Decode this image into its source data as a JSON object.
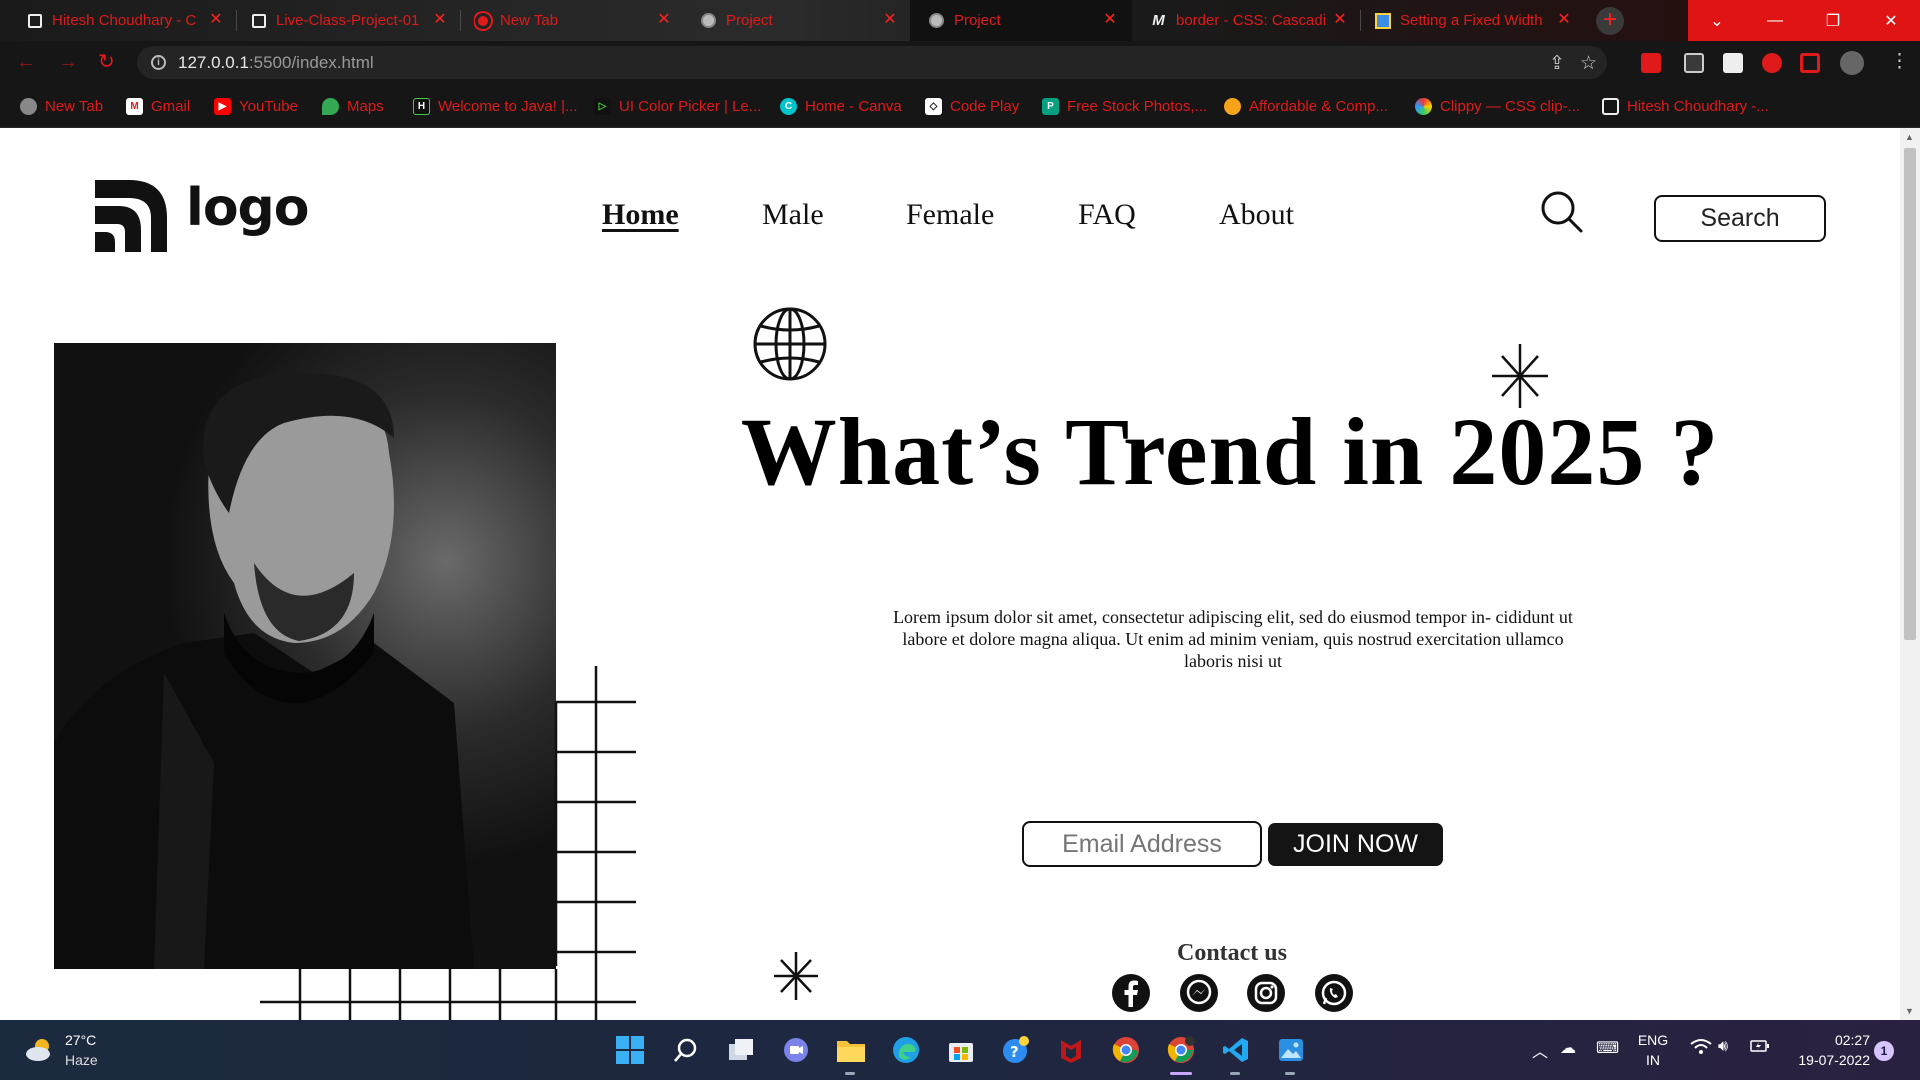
{
  "browser": {
    "tabs": [
      {
        "title": "Hitesh Choudhary - C",
        "icon": "page-icon"
      },
      {
        "title": "Live-Class-Project-01",
        "icon": "page-icon"
      },
      {
        "title": "New Tab",
        "icon": "chrome-icon"
      },
      {
        "title": "Project",
        "icon": "globe-icon"
      },
      {
        "title": "Project",
        "icon": "globe-icon"
      },
      {
        "title": "border - CSS: Cascadi",
        "icon": "mdn-icon"
      },
      {
        "title": "Setting a Fixed Width",
        "icon": "bookmark-icon"
      }
    ],
    "new_tab_label": "+",
    "window_controls": {
      "dropdown": "⌄",
      "minimize": "—",
      "restore": "❐",
      "close": "✕"
    },
    "url_host": "127.0.0.1",
    "url_path": ":5500/index.html",
    "bookmarks": [
      "New Tab",
      "Gmail",
      "YouTube",
      "Maps",
      "Welcome to Java! |...",
      "UI Color Picker | Le...",
      "Home - Canva",
      "Code Play",
      "Free Stock Photos,...",
      "Affordable & Comp...",
      "Clippy — CSS clip-...",
      "Hitesh Choudhary -..."
    ]
  },
  "site": {
    "logo_text": "logo",
    "nav": [
      "Home",
      "Male",
      "Female",
      "FAQ",
      "About"
    ],
    "search_label": "Search",
    "headline": "What’s Trend in 2025 ?",
    "lead": "Lorem ipsum dolor sit amet, consectetur adipiscing elit, sed do eiusmod tempor in- cididunt ut labore et dolore magna aliqua. Ut enim ad minim veniam, quis nostrud exercitation ullamco laboris nisi ut",
    "email_placeholder": "Email Address",
    "join_label": "JOIN NOW",
    "contact_title": "Contact us",
    "social": [
      "facebook-icon",
      "messenger-icon",
      "instagram-icon",
      "whatsapp-icon"
    ]
  },
  "taskbar": {
    "temperature": "27°C",
    "condition": "Haze",
    "lang_top": "ENG",
    "lang_bottom": "IN",
    "time": "02:27",
    "date": "19-07-2022",
    "notifications": "1"
  },
  "colors": {
    "accent_red": "#e01a1a",
    "page_bg": "#ffffff",
    "button_dark": "#141414"
  }
}
